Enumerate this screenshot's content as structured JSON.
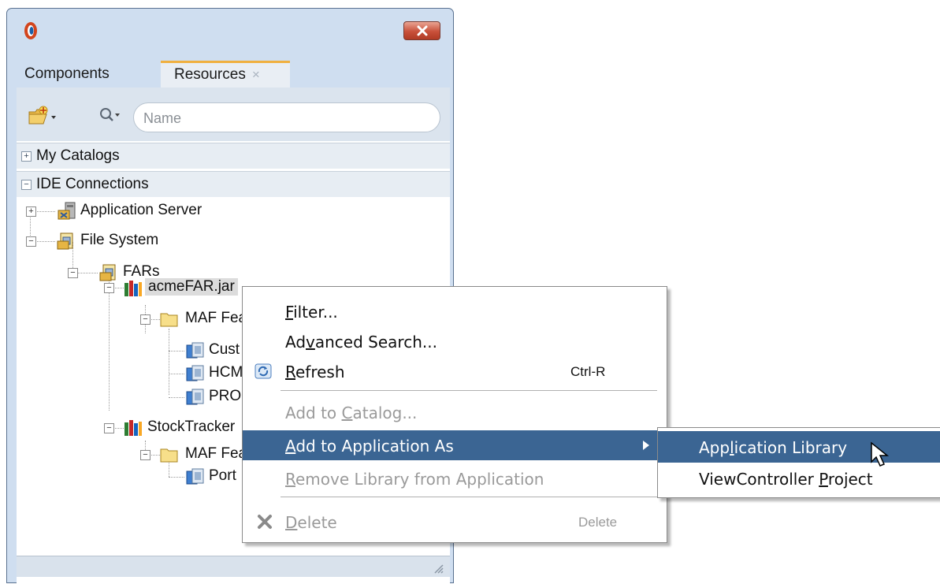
{
  "window": {
    "tabs": [
      {
        "label": "Components"
      },
      {
        "label": "Resources",
        "close": "×"
      }
    ]
  },
  "search": {
    "placeholder": "Name"
  },
  "sections": {
    "my_catalogs": {
      "label": "My Catalogs",
      "toggle": "+"
    },
    "ide_connections": {
      "label": "IDE Connections",
      "toggle": "−"
    }
  },
  "tree": [
    {
      "label": "Application Server",
      "expander": "+"
    },
    {
      "label": "File System",
      "expander": "−"
    },
    {
      "label": "FARs",
      "expander": "−"
    },
    {
      "label": "acmeFAR.jar",
      "expander": "−"
    },
    {
      "label": "MAF Fea",
      "expander": "−"
    },
    {
      "label": "Cust"
    },
    {
      "label": "HCM"
    },
    {
      "label": "PRO"
    },
    {
      "label": "StockTracker",
      "expander": "−"
    },
    {
      "label": "MAF Fea",
      "expander": "−"
    },
    {
      "label": "Port"
    }
  ],
  "context_menu": {
    "items": [
      {
        "pre": "",
        "u": "F",
        "post": "ilter...",
        "shortcut": ""
      },
      {
        "pre": "Ad",
        "u": "v",
        "post": "anced Search...",
        "shortcut": ""
      },
      {
        "pre": "",
        "u": "R",
        "post": "efresh",
        "shortcut": "Ctrl-R"
      },
      {
        "pre": "Add to ",
        "u": "C",
        "post": "atalog...",
        "shortcut": ""
      },
      {
        "pre": "",
        "u": "A",
        "post": "dd to Application As",
        "shortcut": ""
      },
      {
        "pre": "",
        "u": "R",
        "post": "emove Library from Application",
        "shortcut": ""
      },
      {
        "pre": "",
        "u": "D",
        "post": "elete",
        "shortcut": "Delete"
      }
    ]
  },
  "submenu": {
    "items": [
      {
        "pre": "App",
        "u": "l",
        "post": "ication Library"
      },
      {
        "pre": "ViewController ",
        "u": "P",
        "post": "roject"
      }
    ]
  },
  "colors": {
    "highlight": "#3b6593",
    "accent_tab": "#f0b040",
    "window_chrome": "#cfdef0"
  }
}
